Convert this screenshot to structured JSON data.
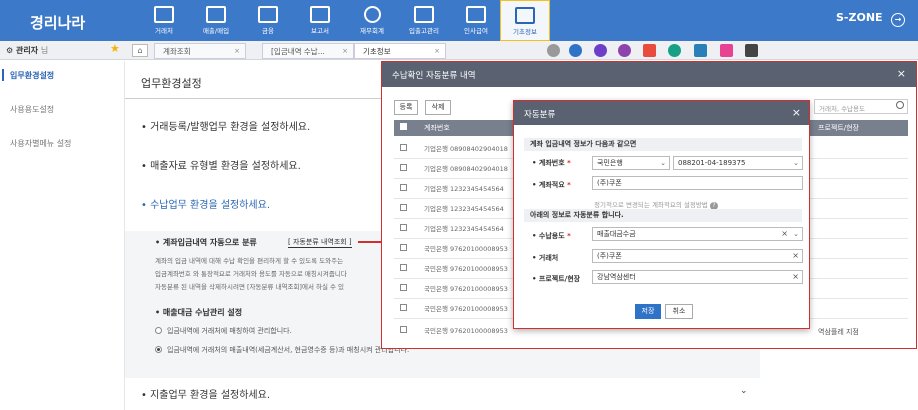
{
  "app": {
    "logo": "경리나라",
    "szone": "S-ZONE"
  },
  "nav": [
    {
      "label": "거래처",
      "icon": "building-icon"
    },
    {
      "label": "매출/매입",
      "icon": "exchange-icon"
    },
    {
      "label": "금융",
      "icon": "card-icon"
    },
    {
      "label": "보고서",
      "icon": "report-icon"
    },
    {
      "label": "재무회계",
      "icon": "dollar-icon"
    },
    {
      "label": "입출고관리",
      "icon": "box-icon"
    },
    {
      "label": "인사급여",
      "icon": "people-icon"
    },
    {
      "label": "기초정보",
      "icon": "gear-icon"
    }
  ],
  "user": {
    "name": "관리자",
    "suffix": "님"
  },
  "tabs": [
    "계좌조회",
    "[입금내역 수납...",
    "기초정보"
  ],
  "sidebar": [
    "입무환경설정",
    "사용용도설정",
    "사용자별메뉴 설정"
  ],
  "main": {
    "title": "업무환경설정",
    "sections": [
      "거래등록/발행업무 환경을 설정하세요.",
      "매출자료 유형별 환경을 설정하세요.",
      "수납업무 환경을 설정하세요.",
      "지출업무 환경을 설정하세요."
    ],
    "auto_class": {
      "heading": "• 계좌입금내역 자동으로 분류",
      "link": "[ 자동분류 내역조회 ]",
      "desc": [
        "계좌의 입금 내역에 대해 수납 확인을 편리하게 할 수 있도록 도와주는",
        "입금계좌번호 와 통장적요로 거래처와 용도를 자동으로 매칭시켜줍니다",
        "자동분류 된 내역을 삭제하시려면 [자동분류 내역조회]에서 하실 수 있"
      ]
    },
    "sales": {
      "heading": "• 매출대금 수납관리 설정",
      "options": [
        "입금내역에 거래처에 매칭하여 관리합니다.",
        "입금내역에 거래처의 매출내역(세금계산서, 현금영수증 등)과 매칭시켜 관리합니다."
      ],
      "selected": 1
    }
  },
  "modal1": {
    "title": "수납확인 자동분류 내역",
    "btn_register": "등록",
    "btn_delete": "삭제",
    "search_placeholder": "거래처, 수납용도",
    "col_account": "계좌번호",
    "col_project": "프로젝트/현장",
    "rows": [
      "기업은행 08908402904018",
      "기업은행 08908402904018",
      "기업은행 1232345454564",
      "기업은행 1232345454564",
      "기업은행 1232345454564",
      "국민은행 97620100008953",
      "국민은행 97620100008953",
      "국민은행 97620100008953",
      "국민은행 97620100008953",
      "국민은행 97620100008953",
      "국민은행 97620100008953"
    ],
    "last_row_project": "역삼플레 지점"
  },
  "modal2": {
    "title": "자동분류",
    "band1": "계좌 입금내역 정보가 다음과 같으면",
    "label_account": "계좌번호",
    "bank": "국민은행",
    "account_no": "088201-04-189375",
    "label_memo": "계좌적요",
    "memo": "(주)쿠폰",
    "hint": "정기적으로 변경되는 계좌적요의 설정방법",
    "band2": "아래의 정보로 자동분류 합니다.",
    "label_use": "수납용도",
    "use": "매출대금수금",
    "label_client": "거래처",
    "client": "(주)쿠폰",
    "label_project": "프로젝트/현장",
    "project": "강남역삼센터",
    "save": "저장",
    "cancel": "취소"
  }
}
